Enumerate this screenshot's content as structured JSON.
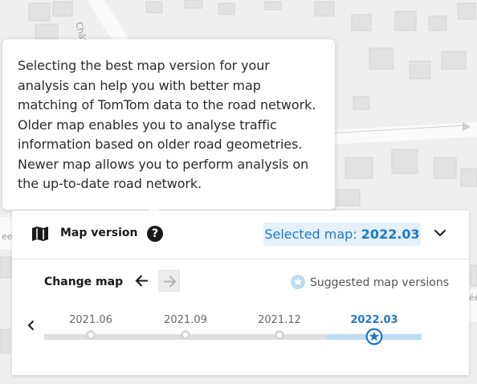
{
  "map": {
    "street_label": "Châtillo",
    "side_label_left": "ee",
    "side_label_right": "ée"
  },
  "tooltip": {
    "text": "Selecting the best map version for your analysis can help you with better map matching of TomTom data to the road network. Older map enables you to analyse traffic information based on older road geometries. Newer map allows you to perform analysis on the up-to-date road network."
  },
  "panel": {
    "title": "Map version",
    "help_icon": "?",
    "selected_prefix": "Selected map: ",
    "selected_value": "2022.03",
    "change_map_label": "Change map",
    "suggested_label": "Suggested map versions",
    "versions": [
      "2021.06",
      "2021.09",
      "2021.12",
      "2022.03"
    ],
    "selected_version": "2022.03"
  },
  "icons": {
    "map": "map-icon",
    "help": "help-icon",
    "chevron": "chevron-down-icon",
    "prev_version": "arrow-left-icon",
    "next_version": "arrow-right-icon",
    "suggested": "star-icon",
    "timeline_prev": "chevron-left-icon"
  },
  "colors": {
    "accent": "#1f78c8",
    "badge_bg": "#e4f0fa",
    "timeline_active": "#bcdcf3"
  }
}
